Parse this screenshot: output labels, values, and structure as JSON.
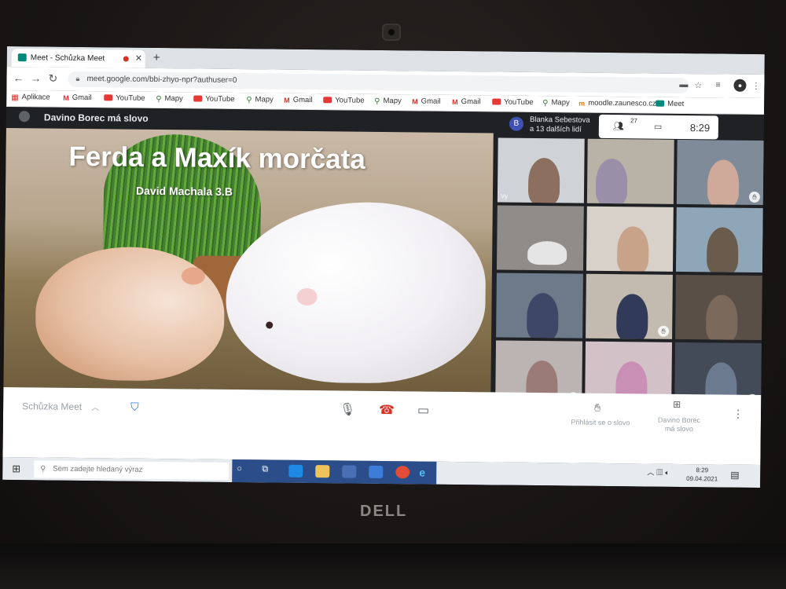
{
  "browser": {
    "tab_title": "Meet - Schůzka Meet",
    "new_tab": "+",
    "url": "meet.google.com/bbi-zhyo-npr?authuser=0",
    "bookmarks": [
      {
        "label": "Aplikace",
        "icon": "apps-icon"
      },
      {
        "label": "Gmail",
        "icon": "gmail-icon"
      },
      {
        "label": "YouTube",
        "icon": "youtube-icon"
      },
      {
        "label": "Mapy",
        "icon": "maps-icon"
      },
      {
        "label": "YouTube",
        "icon": "youtube-icon"
      },
      {
        "label": "Mapy",
        "icon": "maps-icon"
      },
      {
        "label": "Gmail",
        "icon": "gmail-icon"
      },
      {
        "label": "YouTube",
        "icon": "youtube-icon"
      },
      {
        "label": "Mapy",
        "icon": "maps-icon"
      },
      {
        "label": "Gmail",
        "icon": "gmail-icon"
      },
      {
        "label": "Gmail",
        "icon": "gmail-icon"
      },
      {
        "label": "YouTube",
        "icon": "youtube-icon"
      },
      {
        "label": "Mapy",
        "icon": "maps-icon"
      },
      {
        "label": "moodle.zaunesco.cz",
        "icon": "moodle-icon"
      },
      {
        "label": "Meet",
        "icon": "meet-icon"
      }
    ]
  },
  "meet": {
    "presenter_title": "Davino Borec má slovo",
    "participants_line1": "Blanka Sebestova",
    "participants_line2": "a 13 dalších lidí",
    "avatar_letter": "B",
    "participant_count": "27",
    "time": "8:29",
    "slide": {
      "title": "Ferda a Maxík morčata",
      "author": "David Machala 3.B"
    },
    "self_label": "Vy",
    "meeting_name": "Schůzka Meet",
    "raise_hand_label": "Přihlásit se o slovo",
    "present_label_1": "Davino Borec",
    "present_label_2": "má slovo"
  },
  "taskbar": {
    "search_placeholder": "Sem zadejte hledaný výraz",
    "clock_time": "8:29",
    "clock_date": "09.04.2021"
  },
  "laptop": {
    "brand": "DELL"
  }
}
